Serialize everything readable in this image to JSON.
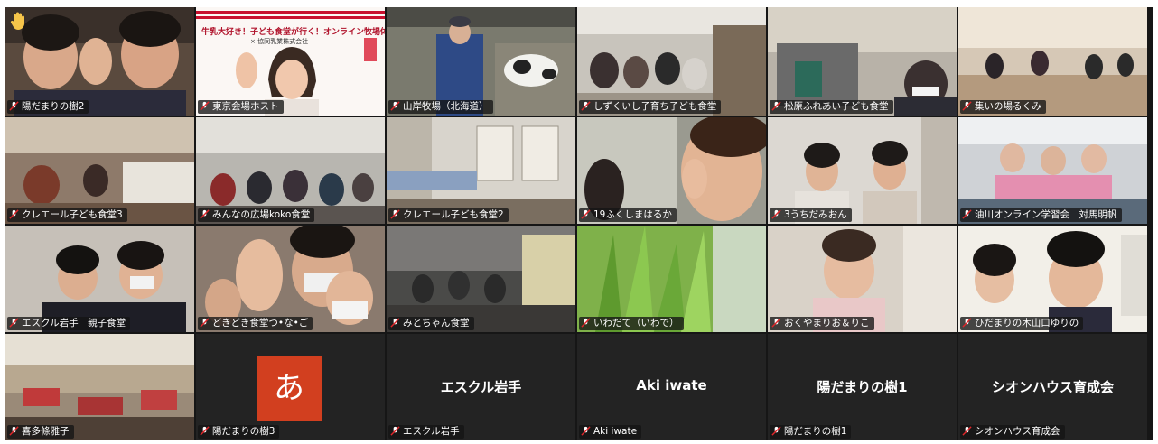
{
  "meeting": {
    "reaction_icon": "raised-hand-icon",
    "muted_icon": "mic-muted-icon",
    "active_speaker_color": "#b6e24a",
    "host_banner": {
      "line1": "牛乳大好き！子ども食堂が行く！オンライン牧場体験",
      "line2": "× 協同乳業株式会社"
    },
    "avatar_initial": "あ"
  },
  "tiles": [
    {
      "label": "陽だまりの樹2"
    },
    {
      "label": "東京会場ホスト"
    },
    {
      "label": "山岸牧場（北海道）"
    },
    {
      "label": "しずくいし子育ち子ども食堂"
    },
    {
      "label": "松原ふれあい子ども食堂"
    },
    {
      "label": "集いの場るくみ"
    },
    {
      "label": "クレエール子ども食堂3"
    },
    {
      "label": "みんなの広場koko食堂"
    },
    {
      "label": "クレエール子ども食堂2"
    },
    {
      "label": "19ふくしまはるか"
    },
    {
      "label": "3うちだみおん"
    },
    {
      "label": "油川オンライン学習会　対馬明帆"
    },
    {
      "label": "エスクル岩手　親子食堂"
    },
    {
      "label": "どきどき食堂つ•な•ご"
    },
    {
      "label": "みとちゃん食堂"
    },
    {
      "label": "いわだて（いわで）"
    },
    {
      "label": "おくやまりお＆りこ"
    },
    {
      "label": "ひだまりの木山口ゆりの"
    },
    {
      "label": "喜多條雅子"
    },
    {
      "label": "陽だまりの樹3"
    },
    {
      "label": "エスクル岩手",
      "center": "エスクル岩手"
    },
    {
      "label": "Aki iwate",
      "center": "Aki iwate"
    },
    {
      "label": "陽だまりの樹1",
      "center": "陽だまりの樹1"
    },
    {
      "label": "シオンハウス育成会",
      "center": "シオンハウス育成会"
    }
  ]
}
